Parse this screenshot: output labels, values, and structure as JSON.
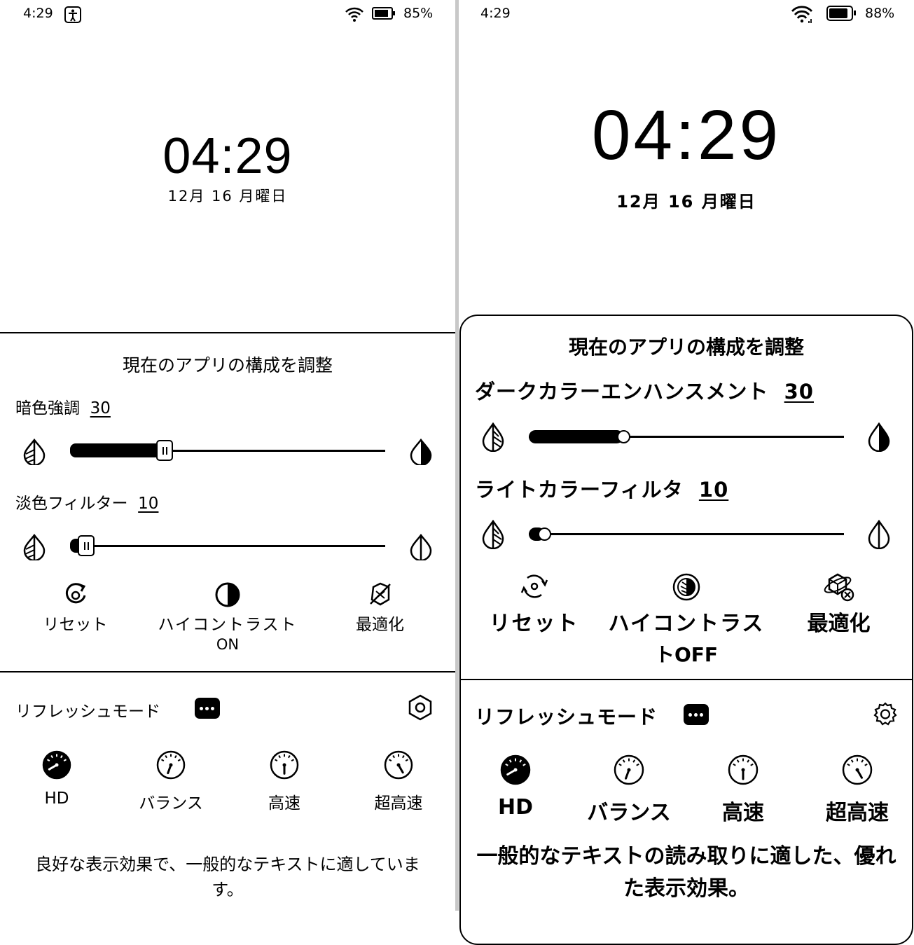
{
  "left": {
    "status": {
      "time": "4:29",
      "battery": "85%",
      "battery_level": 0.85
    },
    "clock": {
      "time": "04:29",
      "date": "12月 16 月曜日"
    },
    "panel": {
      "title": "現在のアプリの構成を調整",
      "dark": {
        "label": "暗色強調",
        "value": "30",
        "level": 0.3
      },
      "light": {
        "label": "淡色フィルター",
        "value": "10",
        "level": 0.05
      },
      "actions": {
        "reset": "リセット",
        "contrast_line1": "ハイコントラスト",
        "contrast_line2": "ON",
        "optimize": "最適化"
      },
      "refresh": {
        "title": "リフレッシュモード",
        "modes": [
          "HD",
          "バランス",
          "高速",
          "超高速"
        ],
        "description": "良好な表示効果で、一般的なテキストに適していま",
        "description2": "す。"
      }
    }
  },
  "right": {
    "status": {
      "time": "4:29",
      "battery": "88%",
      "battery_level": 0.88
    },
    "clock": {
      "time": "04:29",
      "date": "12月 16 月曜日"
    },
    "panel": {
      "title": "現在のアプリの構成を調整",
      "dark": {
        "label": "ダークカラーエンハンスメント",
        "value": "30",
        "level": 0.3
      },
      "light": {
        "label": "ライトカラーフィルタ",
        "value": "10",
        "level": 0.05
      },
      "actions": {
        "reset": "リセット",
        "contrast_line1": "ハイコントラス",
        "contrast_line2": "トOFF",
        "optimize": "最適化"
      },
      "refresh": {
        "title": "リフレッシュモード",
        "modes": [
          "HD",
          "バランス",
          "高速",
          "超高速"
        ],
        "description": "一般的なテキストの読み取りに適した、優れ",
        "description2": "た表示効果。"
      }
    }
  },
  "icons": {
    "accessibility": "accessibility-icon",
    "wifi": "wifi-icon",
    "battery": "battery-icon",
    "dark_low": "droplet-half-hatched-icon",
    "dark_high": "droplet-half-filled-icon",
    "light_high": "droplet-outline-icon",
    "reset": "reset-icon",
    "contrast": "contrast-icon",
    "optimize": "optimize-icon",
    "more": "more-icon",
    "settings": "settings-icon",
    "gauge": "gauge-icon"
  }
}
